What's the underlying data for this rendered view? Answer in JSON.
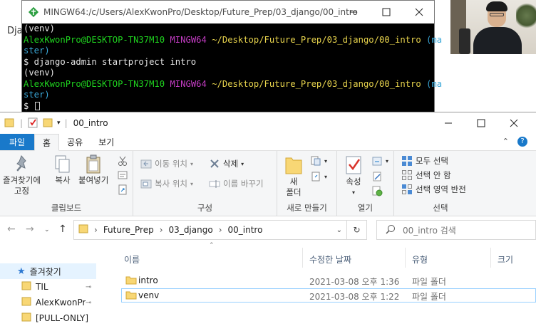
{
  "background": {
    "left_text": "Dja"
  },
  "terminal": {
    "title": "MINGW64:/c/Users/AlexKwonPro/Desktop/Future_Prep/03_django/00_intro",
    "minimize_icon": "minimize-icon",
    "maximize_icon": "maximize-icon",
    "close_icon": "close-icon",
    "lines": {
      "l1": "(venv)",
      "l2_user": "AlexKwonPro@DESKTOP-TN37M10",
      "l2_env": "MINGW64",
      "l2_path": "~/Desktop/Future_Prep/03_django/00_intro",
      "l2_branch": "(ma",
      "l3": "ster)",
      "l4": "$ django-admin startproject intro",
      "l5": "(venv)",
      "l6_user": "AlexKwonPro@DESKTOP-TN37M10",
      "l6_env": "MINGW64",
      "l6_path": "~/Desktop/Future_Prep/03_django/00_intro",
      "l6_branch": "(ma",
      "l7": "ster)",
      "l8": "$ "
    }
  },
  "explorer": {
    "title": "00_intro",
    "tabs": {
      "file": "파일",
      "home": "홈",
      "share": "공유",
      "view": "보기"
    },
    "ribbon": {
      "clipboard": {
        "pin_label_1": "즐겨찾기에",
        "pin_label_2": "고정",
        "copy": "복사",
        "paste": "붙여넣기",
        "group": "클립보드"
      },
      "organize": {
        "move_to": "이동 위치",
        "copy_to": "복사 위치",
        "delete": "삭제",
        "rename": "이름 바꾸기",
        "group": "구성"
      },
      "new": {
        "new_label_1": "새",
        "new_label_2": "폴더",
        "group": "새로 만들기"
      },
      "open": {
        "properties": "속성",
        "group": "열기"
      },
      "select": {
        "select_all": "모두 선택",
        "select_none": "선택 안 함",
        "invert": "선택 영역 반전",
        "group": "선택"
      }
    },
    "address": {
      "crumbs": [
        "Future_Prep",
        "03_django",
        "00_intro"
      ],
      "search_placeholder": "00_intro 검색"
    },
    "nav": {
      "quick_access": "즐겨찾기",
      "items": [
        "TIL",
        "AlexKwonPro",
        "[PULL-ONLY]"
      ]
    },
    "columns": {
      "name": "이름",
      "modified": "수정한 날짜",
      "type": "유형",
      "size": "크기"
    },
    "files": [
      {
        "name": "intro",
        "modified": "2021-03-08 오후 1:36",
        "type": "파일 폴더"
      },
      {
        "name": "venv",
        "modified": "2021-03-08 오후 1:22",
        "type": "파일 폴더"
      }
    ]
  },
  "colors": {
    "accent": "#1979ca",
    "folder": "#f8d775",
    "terminal_green": "#1fd31f",
    "terminal_magenta": "#c43dc4",
    "terminal_yellow": "#e8d44d",
    "terminal_cyan": "#3aa8d8"
  }
}
